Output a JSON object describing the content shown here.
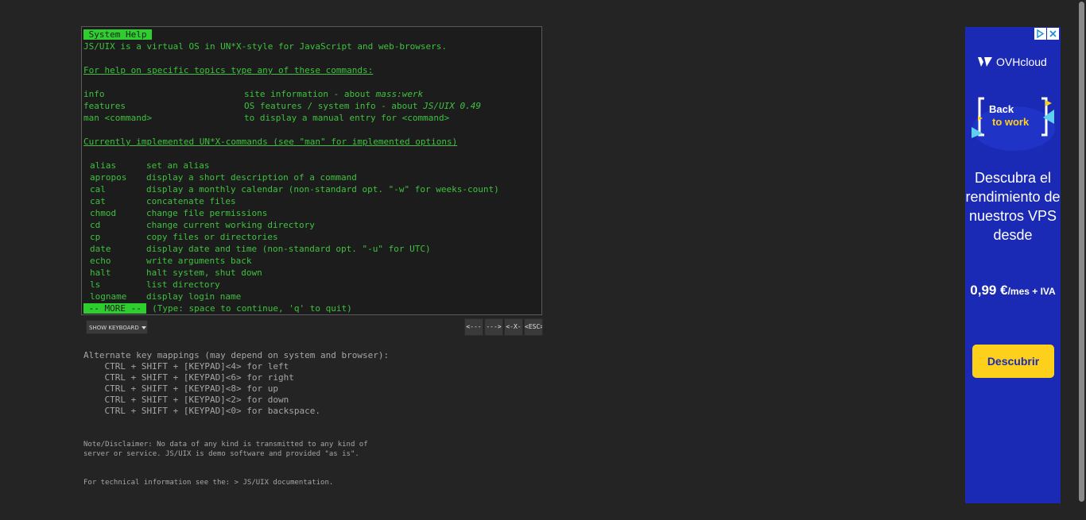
{
  "terminal": {
    "title": " System Help ",
    "intro": "JS/UIX is a virtual OS in UN*X-style for JavaScript and web-browsers.",
    "help_heading": "For help on specific topics type any of these commands:",
    "topics": [
      {
        "cmd": "info",
        "desc": "site information - about ",
        "em": "mass:werk"
      },
      {
        "cmd": "features",
        "desc": "OS features / system info - about ",
        "em": "JS/UIX 0.49"
      },
      {
        "cmd": "man <command>",
        "desc": "to display a manual entry for <command>",
        "em": ""
      }
    ],
    "commands_heading": "Currently implemented UN*X-commands (see \"man\" for implemented options)",
    "commands": [
      {
        "cmd": "alias",
        "desc": "set an alias"
      },
      {
        "cmd": "apropos",
        "desc": "display a short description of a command"
      },
      {
        "cmd": "cal",
        "desc": "display a monthly calendar (non-standard opt. \"-w\" for weeks-count)"
      },
      {
        "cmd": "cat",
        "desc": "concatenate files"
      },
      {
        "cmd": "chmod",
        "desc": "change file permissions"
      },
      {
        "cmd": "cd",
        "desc": "change current working directory"
      },
      {
        "cmd": "cp",
        "desc": "copy files or directories"
      },
      {
        "cmd": "date",
        "desc": "display date and time (non-standard opt. \"-u\" for UTC)"
      },
      {
        "cmd": "echo",
        "desc": "write arguments back"
      },
      {
        "cmd": "halt",
        "desc": "halt system, shut down"
      },
      {
        "cmd": "ls",
        "desc": "list directory"
      },
      {
        "cmd": "logname",
        "desc": "display login name"
      }
    ],
    "more_label": " -- MORE -- ",
    "more_hint": " (Type: space to continue, 'q' to quit)"
  },
  "controls": {
    "show_keyboard": "SHOW KEYBOARD",
    "keys": [
      "<---",
      "--->",
      "<-X-",
      "<ESC>"
    ]
  },
  "info": {
    "keymap": "Alternate key mappings (may depend on system and browser):\n    CTRL + SHIFT + [KEYPAD]<4> for left\n    CTRL + SHIFT + [KEYPAD]<6> for right\n    CTRL + SHIFT + [KEYPAD]<8> for up\n    CTRL + SHIFT + [KEYPAD]<2> for down\n    CTRL + SHIFT + [KEYPAD]<0> for backspace.",
    "disclaimer": "Note/Disclaimer: No data of any kind is transmitted to any kind of\nserver or service. JS/UIX is demo software and provided \"as is\".",
    "tech_prefix": "For technical information see the: ",
    "tech_link": "> JS/UIX documentation."
  },
  "ad": {
    "brand": "OVHcloud",
    "visual_line1": "Back",
    "visual_line2": "to work",
    "headline": "Descubra el rendimiento de nuestros VPS desde",
    "price": "0,99 €",
    "price_suffix": "/mes + IVA",
    "cta": "Descubrir",
    "bg_color": "#1a2ab4",
    "cta_color": "#fdd01c"
  }
}
